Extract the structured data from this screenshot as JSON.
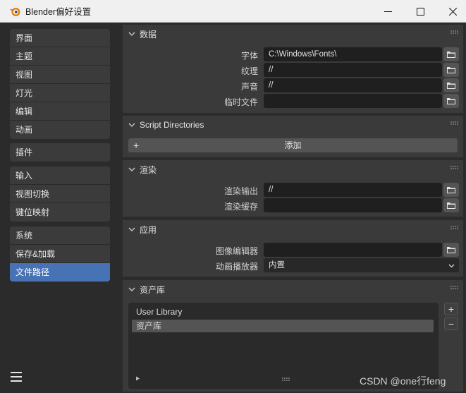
{
  "window": {
    "title": "Blender偏好设置",
    "controls": {
      "minimize": "minimize-icon",
      "maximize": "maximize-icon",
      "close": "close-icon"
    }
  },
  "sidebar": {
    "groups": [
      {
        "items": [
          {
            "label": "界面"
          },
          {
            "label": "主题"
          },
          {
            "label": "视图"
          },
          {
            "label": "灯光"
          },
          {
            "label": "编辑"
          },
          {
            "label": "动画"
          }
        ]
      },
      {
        "items": [
          {
            "label": "插件"
          }
        ]
      },
      {
        "items": [
          {
            "label": "输入"
          },
          {
            "label": "视图切换"
          },
          {
            "label": "键位映射"
          }
        ]
      },
      {
        "items": [
          {
            "label": "系统"
          },
          {
            "label": "保存&加载"
          },
          {
            "label": "文件路径",
            "active": true
          }
        ]
      }
    ]
  },
  "panels": {
    "data": {
      "title": "数据",
      "fields": [
        {
          "label": "字体",
          "value": "C:\\Windows\\Fonts\\"
        },
        {
          "label": "纹理",
          "value": "//"
        },
        {
          "label": "声音",
          "value": "//"
        },
        {
          "label": "临时文件",
          "value": ""
        }
      ]
    },
    "scripts": {
      "title": "Script Directories",
      "add_label": "添加"
    },
    "render": {
      "title": "渲染",
      "fields": [
        {
          "label": "渲染输出",
          "value": "//"
        },
        {
          "label": "渲染缓存",
          "value": ""
        }
      ]
    },
    "apps": {
      "title": "应用",
      "image_editor_label": "图像编辑器",
      "image_editor_value": "",
      "anim_player_label": "动画播放器",
      "anim_player_value": "内置"
    },
    "assets": {
      "title": "资产库",
      "items": [
        {
          "label": "User Library"
        },
        {
          "label": "资产库",
          "selected": true
        }
      ]
    }
  },
  "watermark": "CSDN @one行feng",
  "colors": {
    "accent": "#4772b3",
    "panel": "#3a3a3a",
    "background": "#2b2b2b"
  }
}
